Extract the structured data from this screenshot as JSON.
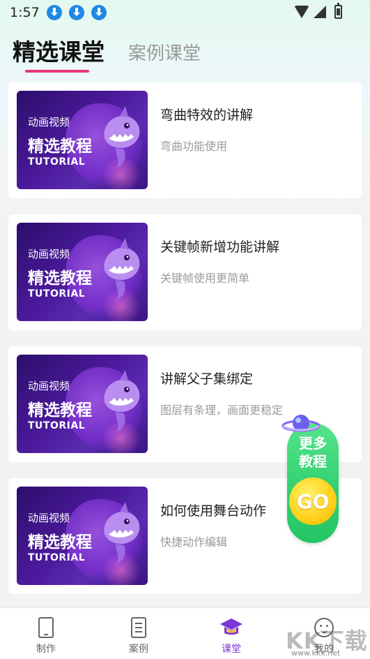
{
  "status_bar": {
    "time": "1:57",
    "notifications": [
      "download-icon",
      "download-icon",
      "download-icon"
    ]
  },
  "tabs": {
    "selected": "精选课堂",
    "other": "案例课堂",
    "accent_color": "#e9347d"
  },
  "courses": [
    {
      "title": "弯曲特效的讲解",
      "subtitle": "弯曲功能使用",
      "thumbnail": {
        "line1": "动画视频",
        "line2": "精选教程",
        "line3": "TUTORIAL"
      }
    },
    {
      "title": "关键帧新增功能讲解",
      "subtitle": "关键帧使用更简单",
      "thumbnail": {
        "line1": "动画视频",
        "line2": "精选教程",
        "line3": "TUTORIAL"
      }
    },
    {
      "title": "讲解父子集绑定",
      "subtitle": "图层有条理，画面更稳定",
      "thumbnail": {
        "line1": "动画视频",
        "line2": "精选教程",
        "line3": "TUTORIAL"
      }
    },
    {
      "title": "如何使用舞台动作",
      "subtitle": "快捷动作编辑",
      "thumbnail": {
        "line1": "动画视频",
        "line2": "精选教程",
        "line3": "TUTORIAL"
      }
    }
  ],
  "floating_button": {
    "text": "更多教程",
    "go": "GO",
    "color": "#2fcf6f"
  },
  "bottom_nav": {
    "items": [
      {
        "label": "制作",
        "icon": "phone-icon"
      },
      {
        "label": "案例",
        "icon": "document-icon"
      },
      {
        "label": "课堂",
        "icon": "graduation-cap-icon",
        "active": true
      },
      {
        "label": "我的",
        "icon": "smile-icon"
      }
    ],
    "active_color": "#7c35d6"
  },
  "watermark": {
    "text": "KK下载",
    "url": "www.kkx.net"
  }
}
